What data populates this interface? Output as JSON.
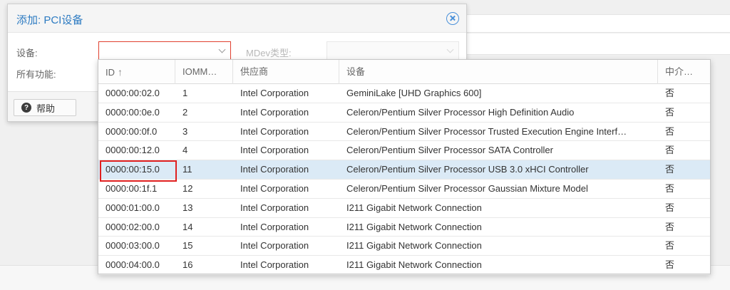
{
  "dialog": {
    "title": "添加: PCI设备",
    "labels": {
      "device": "设备:",
      "all_functions": "所有功能:",
      "mdev_type": "MDev类型:"
    },
    "device_value": "",
    "mdev_value": "",
    "help_label": "帮助"
  },
  "grid": {
    "columns": [
      "ID",
      "IOMM…",
      "供应商",
      "设备",
      "中介…"
    ],
    "sort_indicator": "↑",
    "selected_row": 4,
    "rows": [
      {
        "id": "0000:00:02.0",
        "iommu": "1",
        "vendor": "Intel Corporation",
        "device": "GeminiLake [UHD Graphics 600]",
        "mediated": "否"
      },
      {
        "id": "0000:00:0e.0",
        "iommu": "2",
        "vendor": "Intel Corporation",
        "device": "Celeron/Pentium Silver Processor High Definition Audio",
        "mediated": "否"
      },
      {
        "id": "0000:00:0f.0",
        "iommu": "3",
        "vendor": "Intel Corporation",
        "device": "Celeron/Pentium Silver Processor Trusted Execution Engine Interf…",
        "mediated": "否"
      },
      {
        "id": "0000:00:12.0",
        "iommu": "4",
        "vendor": "Intel Corporation",
        "device": "Celeron/Pentium Silver Processor SATA Controller",
        "mediated": "否"
      },
      {
        "id": "0000:00:15.0",
        "iommu": "11",
        "vendor": "Intel Corporation",
        "device": "Celeron/Pentium Silver Processor USB 3.0 xHCI Controller",
        "mediated": "否"
      },
      {
        "id": "0000:00:1f.1",
        "iommu": "12",
        "vendor": "Intel Corporation",
        "device": "Celeron/Pentium Silver Processor Gaussian Mixture Model",
        "mediated": "否"
      },
      {
        "id": "0000:01:00.0",
        "iommu": "13",
        "vendor": "Intel Corporation",
        "device": "I211 Gigabit Network Connection",
        "mediated": "否"
      },
      {
        "id": "0000:02:00.0",
        "iommu": "14",
        "vendor": "Intel Corporation",
        "device": "I211 Gigabit Network Connection",
        "mediated": "否"
      },
      {
        "id": "0000:03:00.0",
        "iommu": "15",
        "vendor": "Intel Corporation",
        "device": "I211 Gigabit Network Connection",
        "mediated": "否"
      },
      {
        "id": "0000:04:00.0",
        "iommu": "16",
        "vendor": "Intel Corporation",
        "device": "I211 Gigabit Network Connection",
        "mediated": "否"
      }
    ]
  },
  "icons": {
    "close": "close-circle-icon",
    "help": "question-circle-icon",
    "dropdown": "chevron-down-icon",
    "sort": "sort-ascending-icon"
  },
  "colors": {
    "title": "#2d7bc2",
    "selected_row": "#dbeaf6",
    "invalid_border": "#e0402f",
    "annotation": "#e02020"
  }
}
